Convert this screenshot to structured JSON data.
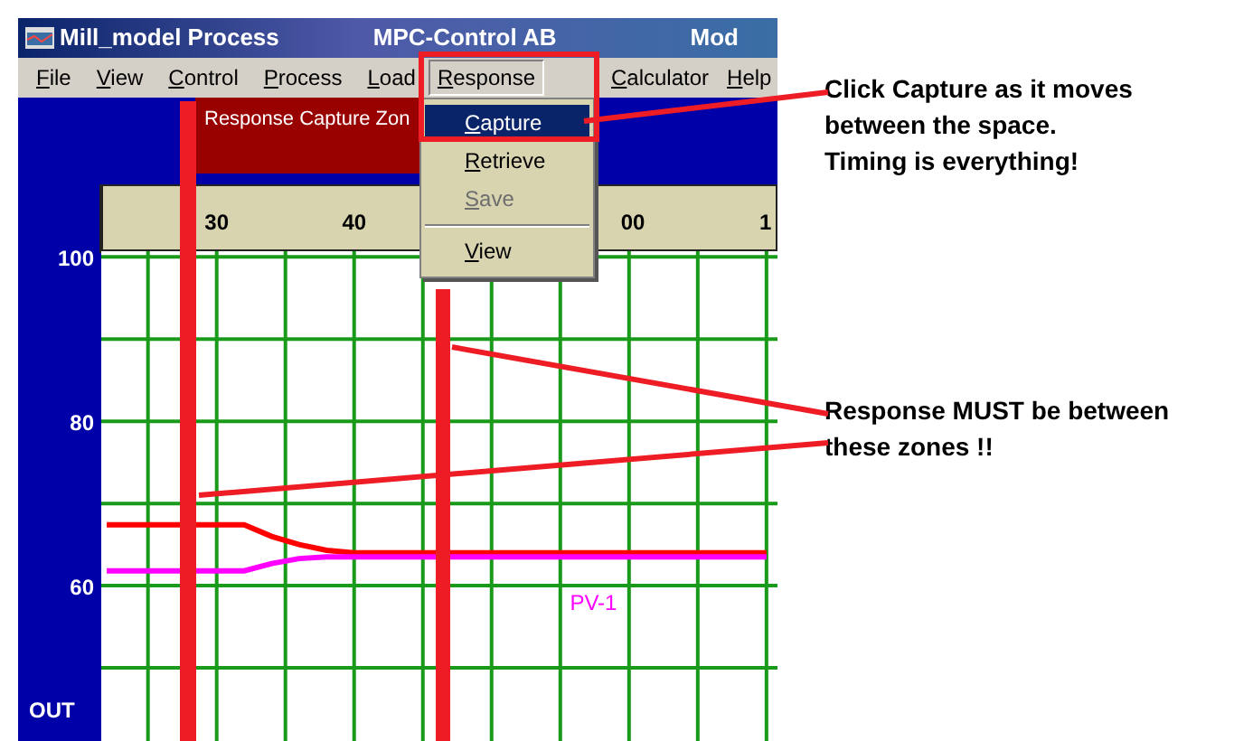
{
  "window": {
    "title": "Mill_model Process",
    "app_name": "MPC-Control AB",
    "title_3": "Mod"
  },
  "menu_bar": [
    {
      "label": "File",
      "selected": false
    },
    {
      "label": "View",
      "selected": false
    },
    {
      "label": "Control",
      "selected": false
    },
    {
      "label": "Process",
      "selected": false
    },
    {
      "label": "Load",
      "selected": false
    },
    {
      "label": "Response",
      "selected": true
    },
    {
      "label": "Calculator",
      "selected": false
    },
    {
      "label": "Help",
      "selected": false
    }
  ],
  "response_menu": [
    {
      "kind": "item",
      "label": "Capture",
      "selected": true,
      "disabled": false
    },
    {
      "kind": "item",
      "label": "Retrieve",
      "selected": false,
      "disabled": false
    },
    {
      "kind": "item",
      "label": "Save",
      "selected": false,
      "disabled": true
    },
    {
      "kind": "separator"
    },
    {
      "kind": "item",
      "label": "View",
      "selected": false,
      "disabled": false
    }
  ],
  "zone_box": {
    "label": "Response Capture Zon"
  },
  "trend": {
    "time_labels": [
      {
        "text": "00"
      },
      {
        "text": "1"
      }
    ],
    "chart_data": {
      "type": "line",
      "ylabel": "OUT",
      "x": [
        22,
        26,
        30,
        32,
        34,
        36,
        38,
        40,
        45,
        50,
        55,
        60,
        65,
        70
      ],
      "series": [
        {
          "color": "#ff0000",
          "values": [
            67.4,
            67.4,
            67.4,
            67.4,
            66,
            65,
            64.3,
            64,
            64,
            64,
            64,
            64,
            64,
            64
          ]
        },
        {
          "name": "PV-1",
          "color": "#ff00ff",
          "values": [
            61.8,
            61.8,
            61.8,
            61.8,
            62.7,
            63.3,
            63.5,
            63.5,
            63.5,
            63.5,
            63.5,
            63.5,
            63.5,
            63.5
          ]
        }
      ],
      "xlim": [
        21.6,
        70.8
      ],
      "ylim": [
        41.1,
        100.7
      ],
      "grid": true,
      "xticks": [
        {
          "value": 30,
          "label": "30"
        },
        {
          "value": 40,
          "label": "40"
        }
      ],
      "yticks": [
        {
          "value": 100,
          "label": "100"
        },
        {
          "value": 80,
          "label": "80"
        },
        {
          "value": 60,
          "label": "60"
        }
      ]
    }
  },
  "annotations": [
    {
      "lines": [
        "Click Capture as it moves",
        "between the space.",
        "Timing is everything!"
      ]
    },
    {
      "lines": [
        "Response MUST be between",
        "these zones !!"
      ]
    }
  ]
}
